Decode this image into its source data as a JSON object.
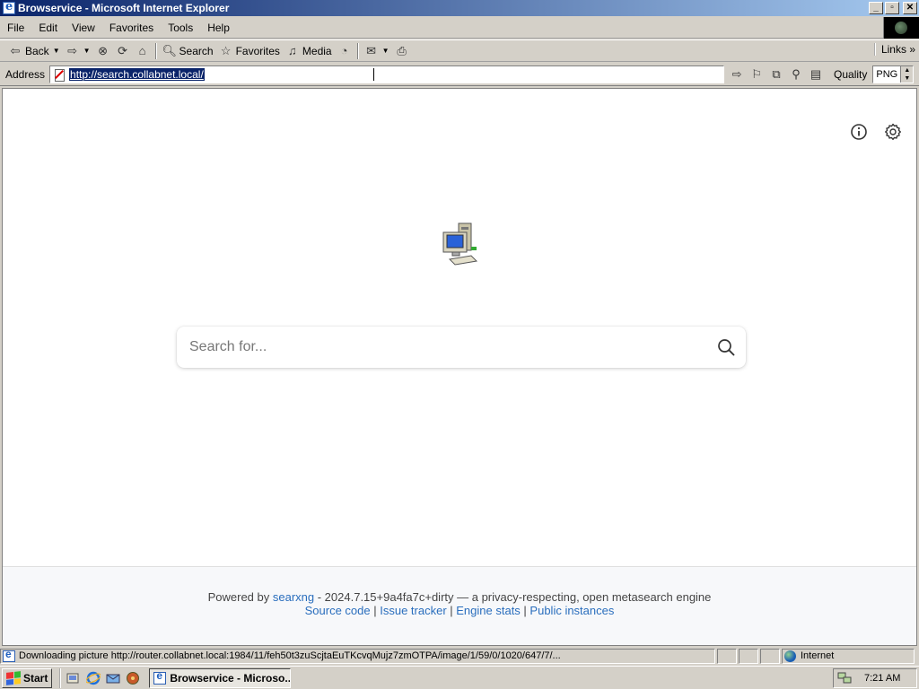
{
  "window": {
    "title": "Browservice - Microsoft Internet Explorer",
    "controls": [
      "_",
      "▫",
      "✕"
    ]
  },
  "menu": [
    "File",
    "Edit",
    "View",
    "Favorites",
    "Tools",
    "Help"
  ],
  "toolbar": {
    "back_label": "Back",
    "search_label": "Search",
    "favorites_label": "Favorites",
    "media_label": "Media",
    "links_label": "Links"
  },
  "address": {
    "label": "Address",
    "url": "http://search.collabnet.local/",
    "quality_label": "Quality",
    "quality_value": "PNG"
  },
  "page": {
    "search_placeholder": "Search for...",
    "footer": {
      "powered_by": "Powered by",
      "engine_link": "searxng",
      "version_text": " - 2024.7.15+9a4fa7c+dirty — a privacy-respecting, open metasearch engine",
      "links": [
        "Source code",
        "Issue tracker",
        "Engine stats",
        "Public instances"
      ],
      "separator": " | "
    }
  },
  "status": {
    "text": "Downloading picture http://router.collabnet.local:1984/11/feh50t3zuScjtaEuTKcvqMujz7zmOTPA/image/1/59/0/1020/647/7/...",
    "zone": "Internet"
  },
  "taskbar": {
    "start_label": "Start",
    "task_label": "Browservice - Microso...",
    "clock": "7:21 AM"
  },
  "colors": {
    "titlebar_start": "#0a246a",
    "titlebar_end": "#a6caf0",
    "link": "#2a6ebd",
    "chrome": "#d4d0c8"
  }
}
